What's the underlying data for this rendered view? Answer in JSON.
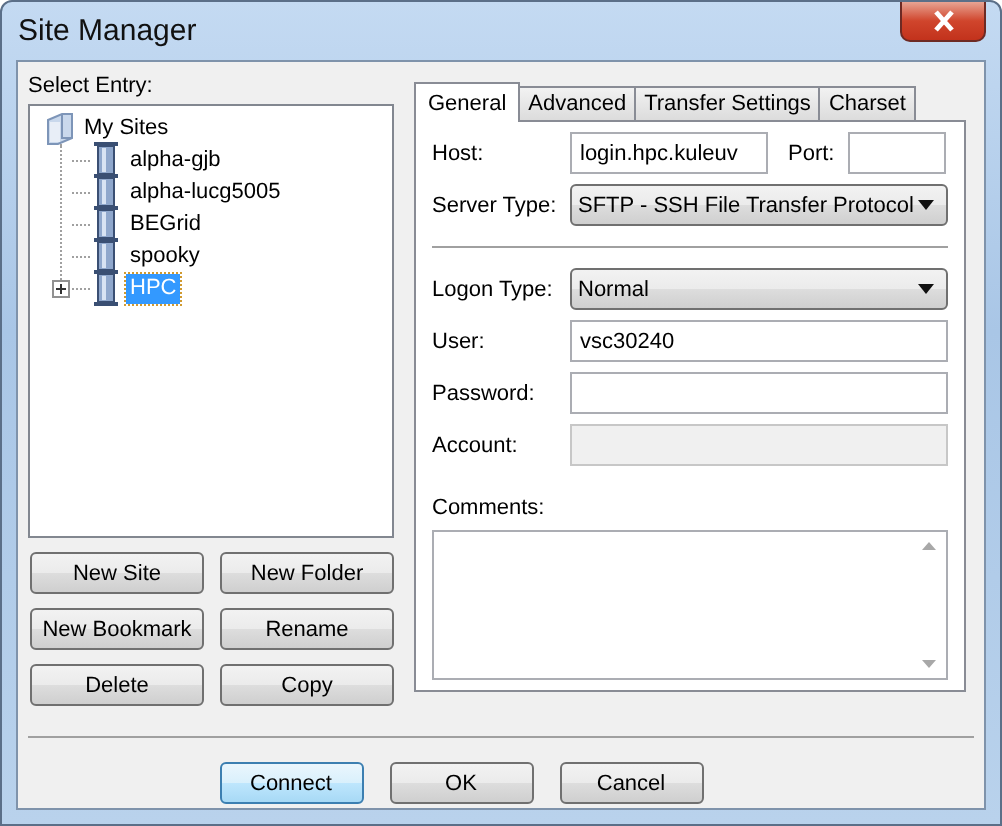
{
  "window": {
    "title": "Site Manager"
  },
  "select_entry_label": "Select Entry:",
  "tree": [
    {
      "label": "My Sites",
      "kind": "folder",
      "expanded": true,
      "selected": false,
      "children": [
        {
          "label": "alpha-gjb",
          "kind": "site",
          "selected": false
        },
        {
          "label": "alpha-lucg5005",
          "kind": "site",
          "selected": false
        },
        {
          "label": "BEGrid",
          "kind": "site",
          "selected": false
        },
        {
          "label": "spooky",
          "kind": "site",
          "selected": false
        },
        {
          "label": "HPC",
          "kind": "site",
          "selected": true,
          "expanded": false
        }
      ]
    }
  ],
  "left_buttons": [
    "New Site",
    "New Folder",
    "New Bookmark",
    "Rename",
    "Delete",
    "Copy"
  ],
  "tabs": [
    {
      "label": "General",
      "selected": true
    },
    {
      "label": "Advanced",
      "selected": false
    },
    {
      "label": "Transfer Settings",
      "selected": false
    },
    {
      "label": "Charset",
      "selected": false
    }
  ],
  "general": {
    "host": {
      "label": "Host:",
      "value": "login.hpc.kuleuv"
    },
    "port": {
      "label": "Port:"
    },
    "server_type": {
      "label": "Server Type:",
      "value": "SFTP - SSH File Transfer Protocol"
    },
    "logon_type": {
      "label": "Logon Type:",
      "value": "Normal"
    },
    "user": {
      "label": "User:",
      "value": "vsc30240",
      "disabled": false
    },
    "password": {
      "label": "Password:",
      "disabled": false
    },
    "account": {
      "label": "Account:",
      "disabled": true
    },
    "comments": {
      "label": "Comments:"
    }
  },
  "bottom_buttons": [
    {
      "label": "Connect",
      "default": true
    },
    {
      "label": "OK",
      "default": false
    },
    {
      "label": "Cancel",
      "default": false
    }
  ]
}
